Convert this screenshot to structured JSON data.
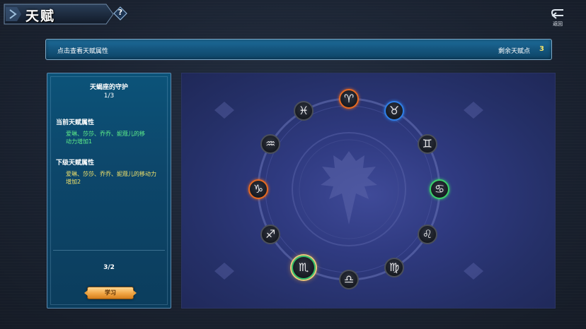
{
  "header": {
    "title": "天赋",
    "help_symbol": "?",
    "back_label": "返回"
  },
  "info_bar": {
    "hint": "点击查看天赋属性",
    "remaining_label": "剩余天赋点",
    "remaining_count": "3"
  },
  "detail_panel": {
    "title": "天蝎座的守护",
    "level": "1/3",
    "current_heading": "当前天赋属性",
    "current_text": "爱琳、莎莎、乔乔、妮蔻儿的移动力增加1",
    "next_heading": "下级天赋属性",
    "next_text": "爱琳、莎莎、乔乔、妮蔻儿的移动力增加2",
    "progress": "3/2",
    "learn_button": "学习"
  },
  "wheel": {
    "nodes": [
      {
        "sign": "aries-icon",
        "glyph": "♈",
        "state": "orange"
      },
      {
        "sign": "taurus-icon",
        "glyph": "♉",
        "state": "blue"
      },
      {
        "sign": "gemini-icon",
        "glyph": "♊",
        "state": "normal"
      },
      {
        "sign": "cancer-icon",
        "glyph": "♋",
        "state": "green"
      },
      {
        "sign": "leo-icon",
        "glyph": "♌",
        "state": "normal"
      },
      {
        "sign": "virgo-icon",
        "glyph": "♍",
        "state": "normal"
      },
      {
        "sign": "libra-icon",
        "glyph": "♎",
        "state": "normal"
      },
      {
        "sign": "scorpio-icon",
        "glyph": "♏",
        "state": "selected"
      },
      {
        "sign": "sagittarius-icon",
        "glyph": "♐",
        "state": "normal"
      },
      {
        "sign": "capricorn-icon",
        "glyph": "♑",
        "state": "orange"
      },
      {
        "sign": "aquarius-icon",
        "glyph": "♒",
        "state": "normal"
      },
      {
        "sign": "pisces-icon",
        "glyph": "♓",
        "state": "normal"
      }
    ]
  },
  "colors": {
    "accent_orange": "#e76a22",
    "accent_blue": "#2f7ee6",
    "accent_green": "#3bd16a",
    "highlight_yellow": "#f2e36a",
    "text_green": "#5ff08a"
  }
}
